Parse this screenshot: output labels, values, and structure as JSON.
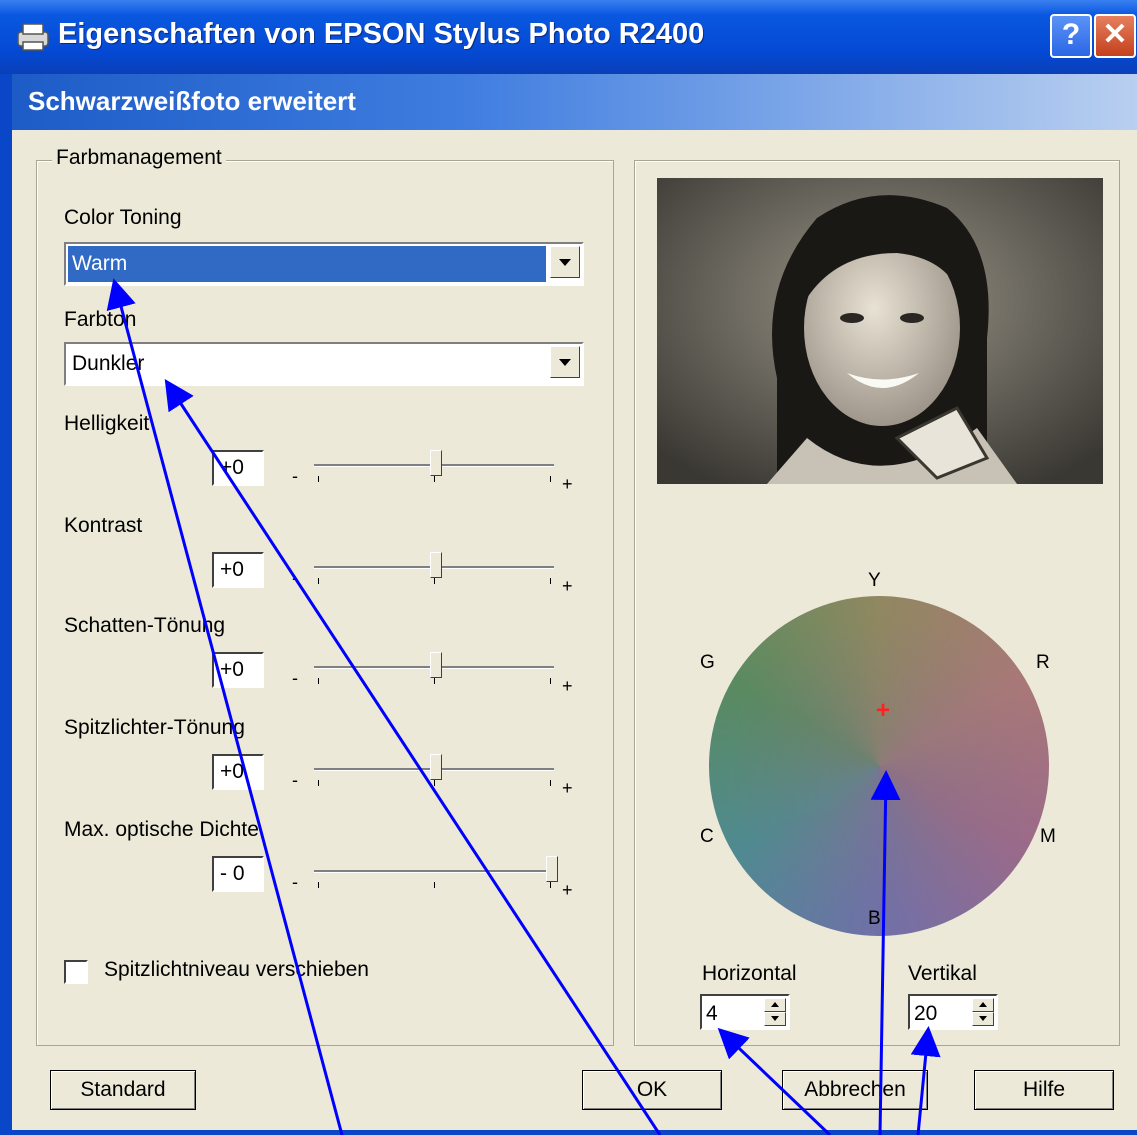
{
  "window": {
    "title": "Eigenschaften von EPSON Stylus Photo R2400",
    "help_label": "?",
    "close_label": "✕"
  },
  "header": {
    "title": "Schwarzweißfoto erweitert"
  },
  "color_management": {
    "group_label": "Farbmanagement",
    "color_toning": {
      "label": "Color Toning",
      "selected": "Warm"
    },
    "hue": {
      "label": "Farbton",
      "selected": "Dunkler"
    },
    "sliders": [
      {
        "label": "Helligkeit",
        "value": "+0",
        "position": 0.5
      },
      {
        "label": "Kontrast",
        "value": "+0",
        "position": 0.5
      },
      {
        "label": "Schatten-Tönung",
        "value": "+0",
        "position": 0.5
      },
      {
        "label": "Spitzlichter-Tönung",
        "value": "+0",
        "position": 0.5
      },
      {
        "label": "Max. optische Dichte",
        "value": "- 0",
        "position": 1.0
      }
    ],
    "minus": "-",
    "plus": "+",
    "shift_highlights": {
      "label": "Spitzlichtniveau verschieben",
      "checked": false
    }
  },
  "color_wheel": {
    "letters": {
      "y": "Y",
      "r": "R",
      "m": "M",
      "b": "B",
      "c": "C",
      "g": "G"
    },
    "marker": "+",
    "horizontal": {
      "label": "Horizontal",
      "value": "4"
    },
    "vertical": {
      "label": "Vertikal",
      "value": "20"
    }
  },
  "buttons": {
    "standard": "Standard",
    "ok": "OK",
    "cancel": "Abbrechen",
    "help": "Hilfe"
  },
  "colors": {
    "titlebar": "#0449d4",
    "selection": "#316ac5",
    "annotation_arrow": "#0000ff",
    "marker": "#ff2020"
  }
}
